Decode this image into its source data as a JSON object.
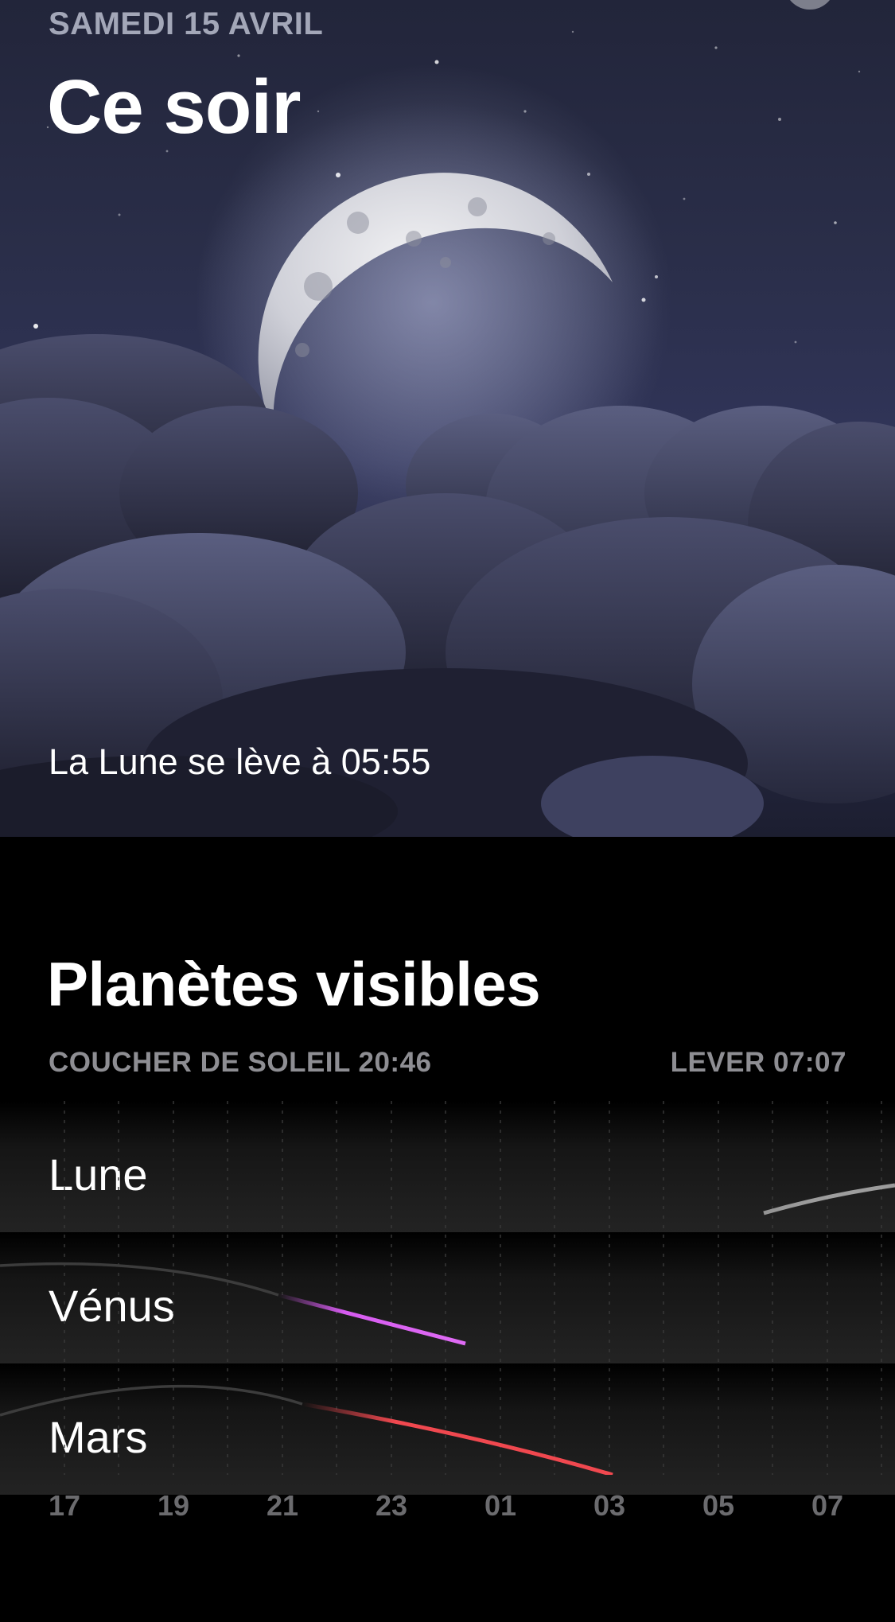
{
  "header": {
    "date": "SAMEDI 15 AVRIL",
    "title": "Ce soir"
  },
  "hero": {
    "moonrise_text": "La Lune se lève à 05:55",
    "icon": "crescent-moon-photo"
  },
  "planets": {
    "title": "Planètes visibles",
    "sunset_label": "COUCHER DE SOLEIL 20:46",
    "sunrise_label": "LEVER 07:07",
    "rows": [
      {
        "name": "Lune",
        "color": "#d8d8d8"
      },
      {
        "name": "Vénus",
        "color": "#d65bf0"
      },
      {
        "name": "Mars",
        "color": "#f0484f"
      }
    ],
    "hours": [
      "17",
      "19",
      "21",
      "23",
      "01",
      "03",
      "05",
      "07"
    ]
  },
  "colors": {
    "background": "#000000",
    "hero_sky": "#2a2e49",
    "muted_text": "#8e8e93",
    "hour_text": "#6b6b6e"
  }
}
